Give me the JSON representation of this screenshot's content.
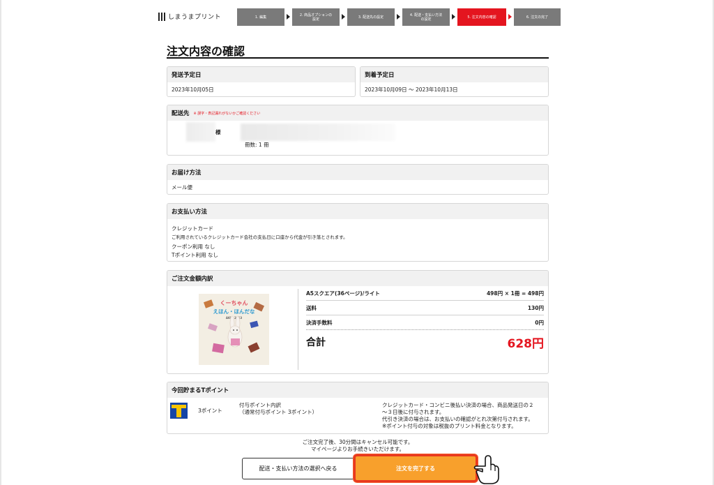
{
  "header": {
    "logo_text": "しまうまプリント",
    "steps": [
      {
        "label": "1. 編集",
        "active": false
      },
      {
        "label": "2. 商品オプションの\n設定",
        "active": false
      },
      {
        "label": "3. 配送先の設定",
        "active": false
      },
      {
        "label": "4. 配送・支払い方法\nの設定",
        "active": false
      },
      {
        "label": "5. 注文内容の確認",
        "active": true
      },
      {
        "label": "6. 注文の完了",
        "active": false
      }
    ]
  },
  "page_title": "注文内容の確認",
  "shipping_date": {
    "heading": "発送予定日",
    "value": "2023年10月05日"
  },
  "arrival_date": {
    "heading": "到着予定日",
    "value": "2023年10月09日 〜 2023年10月13日"
  },
  "destination": {
    "heading": "配送先",
    "note": "※ 誤字・表記漏れがないかご確認ください",
    "honorific": "様",
    "copies": "冊数: 1 冊"
  },
  "delivery": {
    "heading": "お届け方法",
    "value": "メール便"
  },
  "payment": {
    "heading": "お支払い方法",
    "method": "クレジットカード",
    "description": "ご利用されているクレジットカード会社の支払日に口座から代金が引き落とされます。",
    "coupon": "クーポン利用 なし",
    "tpoint": "Tポイント利用 なし"
  },
  "breakdown": {
    "heading": "ご注文金額内訳",
    "cover_title_1": "くーちゃん",
    "cover_title_2": "えほん・ほんだな",
    "cover_title_3": "AKKI 2013",
    "product": "A5スクエア(36ページ)/ライト",
    "product_price": "498円 × 1冊 = 498円",
    "shipping_label": "送料",
    "shipping_value": "130円",
    "fee_label": "決済手数料",
    "fee_value": "0円",
    "total_label": "合計",
    "total_value": "628円"
  },
  "tpoint_earn": {
    "heading": "今回貯まるTポイント",
    "points": "3ポイント",
    "detail_title": "付与ポイント内訳",
    "detail_line": "（通常付与ポイント 3ポイント）",
    "notes": [
      "クレジットカード・コンビニ後払い決済の場合、商品発送日の２",
      "〜３日後に付与されます。",
      "代引き決済の場合は、お支払いの確認がとれ次第付与されます。",
      "※ポイント付与の対象は税抜のプリント料金となります。"
    ]
  },
  "footer_note": [
    "ご注文完了後、30分間はキャンセル可能です。",
    "マイページよりお手続きいただけます。"
  ],
  "buttons": {
    "back": "配送・支払い方法の選択へ戻る",
    "complete": "注文を完了する"
  },
  "colors": {
    "accent_red": "#e4151f",
    "button_orange": "#f8a02c",
    "step_gray": "#7a7a7a"
  }
}
